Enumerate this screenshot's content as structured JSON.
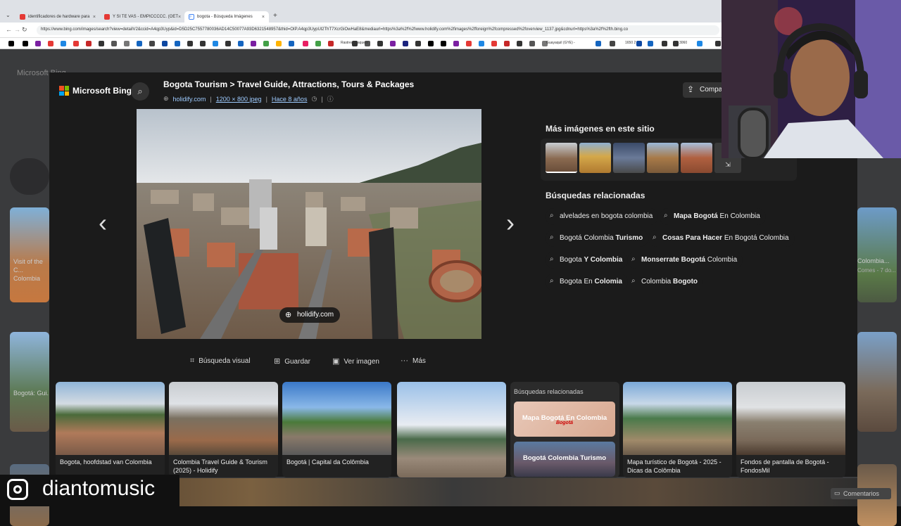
{
  "browser": {
    "tabs": [
      {
        "label": "identificadores de hardware para",
        "color": "#e53935"
      },
      {
        "label": "Y SI TE VAS - EMPICCCCC. (OET",
        "color": "#e53935"
      },
      {
        "label": "bogota - Búsqueda Imágenes",
        "color": "#4285f4"
      }
    ],
    "new_tab": "+",
    "url": "https://www.bing.com/images/search?view=detailV2&ccid=A4qp3Uyp&id=D5D25C7557780036AD14C50077A93D6321548957&thid=OIP.A4qp3UypUl2ThT7XcrGiOwHaE8&mediaurl=https%3a%2f%2fwww.holidify.com%2fimages%2fforeign%2fcompressed%2foverview_1137.jpg&cdnurl=https%3a%2f%2fth.bing.co",
    "bookmarks": [
      "Rastrear Paquete",
      "Guayaquil (GYE) -",
      "1650 2",
      "3060"
    ]
  },
  "bing": {
    "brand": "Microsoft Bing",
    "title": "Bogota Tourism > Travel Guide, Attractions, Tours & Packages",
    "source": "holidify.com",
    "dimensions": "1200 × 800 jpeg",
    "age": "Hace 8 años",
    "share_label": "Compa",
    "source_badge": "holidify.com",
    "actions": {
      "visual": "Búsqueda visual",
      "save": "Guardar",
      "view": "Ver imagen",
      "more": "Más"
    },
    "more_images_title": "Más imágenes en este sitio",
    "related_title": "Búsquedas relacionadas",
    "related": [
      [
        {
          "pre": "alvelades en bogota colombia",
          "bold": "",
          "post": ""
        },
        {
          "pre": "",
          "bold": "Mapa Bogotá",
          "post": " En Colombia"
        }
      ],
      [
        {
          "pre": "Bogotá Colombia ",
          "bold": "Turismo",
          "post": ""
        },
        {
          "pre": "",
          "bold": "Cosas Para Hacer",
          "post": " En Bogotá Colombia"
        }
      ],
      [
        {
          "pre": "Bogota ",
          "bold": "Y Colombia",
          "post": ""
        },
        {
          "pre": "",
          "bold": "Monserrate Bogotá",
          "post": " Colombia"
        }
      ],
      [
        {
          "pre": "Bogota En ",
          "bold": "Colomia",
          "post": ""
        },
        {
          "pre": "Colombia ",
          "bold": "Bogoto",
          "post": ""
        }
      ]
    ],
    "strip": [
      {
        "caption": "Bogota, hoofdstad van Colombia"
      },
      {
        "caption": "Colombia Travel Guide & Tourism (2025) - Holidify"
      },
      {
        "caption": "Bogotá | Capital da Colômbia"
      },
      {
        "caption": ""
      },
      {
        "caption": "Mapa turístico de Bogotá - 2025 - Dicas da Colômbia"
      },
      {
        "caption": "Fondos de pantalla de Bogotá - FondosMil"
      }
    ],
    "strip_related_title": "Búsquedas relacionadas",
    "strip_related": [
      "Mapa Bogotá En Colombia",
      "Bogotá Colombia Turismo"
    ],
    "strip_map_label": "Bogotá"
  },
  "background": {
    "left_caption": "Visit of the C... Colombia",
    "left_caption2": "Bogotá: Gui...",
    "right_caption": "Colombia...",
    "right_caption2": "Comes - 7 do...",
    "comments": "Comentarios",
    "header_logo": "Microsoft Bing"
  },
  "watermark": "diantomusic"
}
